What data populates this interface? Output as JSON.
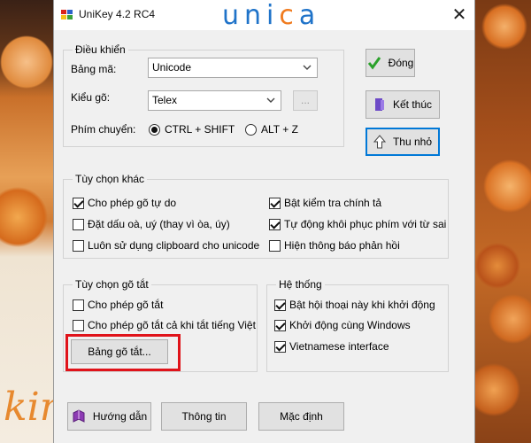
{
  "window": {
    "title": "UniKey 4.2 RC4",
    "brand": [
      "u",
      "n",
      "i",
      "c",
      "a"
    ],
    "close_glyph": "✕"
  },
  "control": {
    "group_title": "Điều khiển",
    "charset_label": "Bảng mã:",
    "charset_value": "Unicode",
    "input_method_label": "Kiểu gõ:",
    "input_method_value": "Telex",
    "input_method_more": "...",
    "switch_key_label": "Phím chuyển:",
    "switch_options": [
      "CTRL + SHIFT",
      "ALT + Z"
    ],
    "switch_selected": "CTRL + SHIFT"
  },
  "buttons": {
    "close_label": "Đóng",
    "exit_label": "Kết thúc",
    "minimize_label": "Thu nhỏ",
    "help_label": "Hướng dẫn",
    "info_label": "Thông tin",
    "default_label": "Mặc định",
    "macro_table_label": "Bảng gõ tắt..."
  },
  "other_options": {
    "group_title": "Tùy chọn khác",
    "left": [
      {
        "label": "Cho phép gõ tự do",
        "checked": true
      },
      {
        "label": "Đặt dấu oà, uý (thay vì òa, úy)",
        "checked": false
      },
      {
        "label": "Luôn sử dụng clipboard cho unicode",
        "checked": false
      }
    ],
    "right": [
      {
        "label": "Bật kiểm tra chính tả",
        "checked": true
      },
      {
        "label": "Tự động khôi phục phím với từ sai",
        "checked": true
      },
      {
        "label": "Hiện thông báo phản hồi",
        "checked": false
      }
    ]
  },
  "macro_options": {
    "group_title": "Tùy chọn gõ tắt",
    "items": [
      {
        "label": "Cho phép gõ tắt",
        "checked": false
      },
      {
        "label": "Cho phép gõ tắt cả khi tắt tiếng Việt",
        "checked": false
      }
    ]
  },
  "system": {
    "group_title": "Hệ thống",
    "items": [
      {
        "label": "Bật hội thoại này khi khởi động",
        "checked": true
      },
      {
        "label": "Khởi động cùng Windows",
        "checked": true
      },
      {
        "label": "Vietnamese interface",
        "checked": true
      }
    ]
  },
  "background": {
    "word": "kin"
  },
  "colors": {
    "accent_blue": "#0078d7",
    "highlight_red": "#e0131a",
    "brand_blue": "#1f73c9",
    "brand_orange": "#f07b1f"
  }
}
